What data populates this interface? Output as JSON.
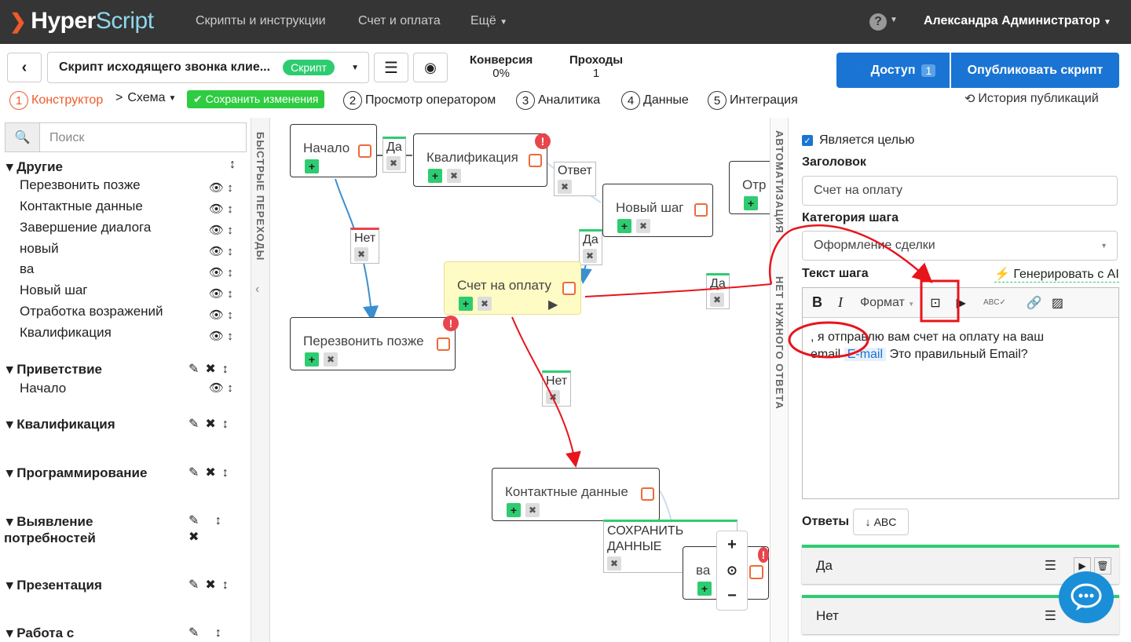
{
  "brand": {
    "logo_main": "Hyper",
    "logo_accent": "Script"
  },
  "topnav": {
    "scripts": "Скрипты и инструкции",
    "billing": "Счет и оплата",
    "more": "Ещё",
    "user": "Александра Администратор"
  },
  "toolbar": {
    "script_name": "Скрипт исходящего звонка клие...",
    "script_badge": "Скрипт",
    "conversion_label": "Конверсия",
    "conversion_value": "0%",
    "passes_label": "Проходы",
    "passes_value": "1",
    "access_label": "Доступ",
    "access_count": "1",
    "publish_label": "Опубликовать скрипт"
  },
  "tabs": {
    "t1_num": "1",
    "t1": "Конструктор",
    "scheme": "Схема",
    "save": "Сохранить изменения",
    "t2_num": "2",
    "t2": "Просмотр оператором",
    "t3_num": "3",
    "t3": "Аналитика",
    "t4_num": "4",
    "t4": "Данные",
    "t5_num": "5",
    "t5": "Интеграция",
    "history": "История публикаций"
  },
  "sidebar": {
    "search_placeholder": "Поиск",
    "groups": [
      "Другие",
      "Приветствие",
      "Квалификация",
      "Программирование",
      "Выявление",
      "потребностей",
      "Презентация",
      "Работа с"
    ],
    "items": [
      "Перезвонить позже",
      "Контактные данные",
      "Завершение диалога",
      "новый",
      "ва",
      "Новый шаг",
      "Отработка возражений",
      "Квалификация",
      "Начало"
    ]
  },
  "quick_transitions": "БЫСТРЫЕ ПЕРЕХОДЫ",
  "automation": "АВТОМАТИЗАЦИЯ",
  "no_answer": "НЕТ НУЖНОГО ОТВЕТА",
  "canvas": {
    "nodes": [
      "Начало",
      "Квалификация",
      "Новый шаг",
      "Отр",
      "Счет на оплату",
      "Перезвонить позже",
      "Контактные данные",
      "ва"
    ],
    "edges": [
      "Да",
      "Ответ",
      "Нет",
      "Да",
      "Да",
      "Нет",
      "СОХРАНИТЬ",
      "ДАННЫЕ"
    ]
  },
  "panel": {
    "is_goal": "Является целью",
    "title_label": "Заголовок",
    "title_value": "Счет на оплату",
    "category_label": "Категория шага",
    "category_value": "Оформление сделки",
    "text_label": "Текст шага",
    "generate_ai": "Генерировать с AI",
    "format": "Формат",
    "text_part1": ", я отправлю вам счет на оплату на ваш",
    "text_part2": "email",
    "text_var": "E-mail",
    "text_part3": "Это правильный Email?",
    "answers_label": "Ответы",
    "sort_label": "ABC",
    "answers": [
      "Да",
      "Нет"
    ]
  },
  "colors": {
    "accent": "#1a74d3",
    "green": "#2ecc71",
    "orange": "#ef5a2b",
    "annotation": "#e8141c"
  }
}
